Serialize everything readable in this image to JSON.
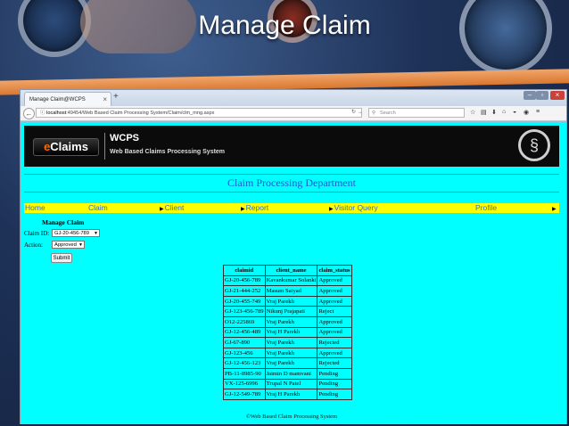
{
  "slide": {
    "title": "Manage Claim"
  },
  "browser": {
    "tab_title": "Manage Claim@WCPS",
    "tab_close": "×",
    "new_tab": "+",
    "url_host": "localhost",
    "url_path": ":49454/Web Based Claim Processing System/Claim/clm_mng.aspx",
    "search_placeholder": "Search"
  },
  "banner": {
    "logo_prefix": "e",
    "logo_text": "Claims",
    "title": "WCPS",
    "subtitle": "Web Based Claims Processing System"
  },
  "department": "Claim Processing Department",
  "menu": [
    {
      "label": "Home"
    },
    {
      "label": "Claim"
    },
    {
      "label": "Client"
    },
    {
      "label": "Report"
    },
    {
      "label": "Visitor Query"
    },
    {
      "label": "Profile"
    }
  ],
  "form": {
    "title": "Manage Claim",
    "claim_id_label": "Claim ID:",
    "claim_id_value": "GJ-20-456-789",
    "action_label": "Action:",
    "action_value": "Approved",
    "submit_label": "Submit"
  },
  "table": {
    "columns": [
      "claimid",
      "client_name",
      "claim_status"
    ],
    "rows": [
      [
        "GJ-20-456-789",
        "Kavankumar Solanki",
        "Approved"
      ],
      [
        "GJ-21-444-252",
        "Masum Saiyad",
        "Approved"
      ],
      [
        "GJ-20-455-749",
        "Vraj Parekh",
        "Approved"
      ],
      [
        "GJ-123-456-789",
        "Nikunj Prajapati",
        "Reject"
      ],
      [
        "O12-225869",
        "Vraj Parekh",
        "Approved"
      ],
      [
        "GJ-12-456-489",
        "Vraj H Parekh",
        "Approved"
      ],
      [
        "GJ-67-890",
        "Vraj Parekh",
        "Rejected"
      ],
      [
        "GJ-123-456",
        "Vraj Parekh",
        "Approved"
      ],
      [
        "GJ-12-456-123",
        "Vraj Parekh",
        "Rejected"
      ],
      [
        "PB-11-8985-90",
        "Jaimin D mamvani",
        "Pending"
      ],
      [
        "VX-125-6996",
        "Trupal N Patel",
        "Pending"
      ],
      [
        "GJ-12-549-789",
        "Vraj H Parekh",
        "Pending"
      ]
    ]
  },
  "footer": "©Web Based Claim Processing System"
}
